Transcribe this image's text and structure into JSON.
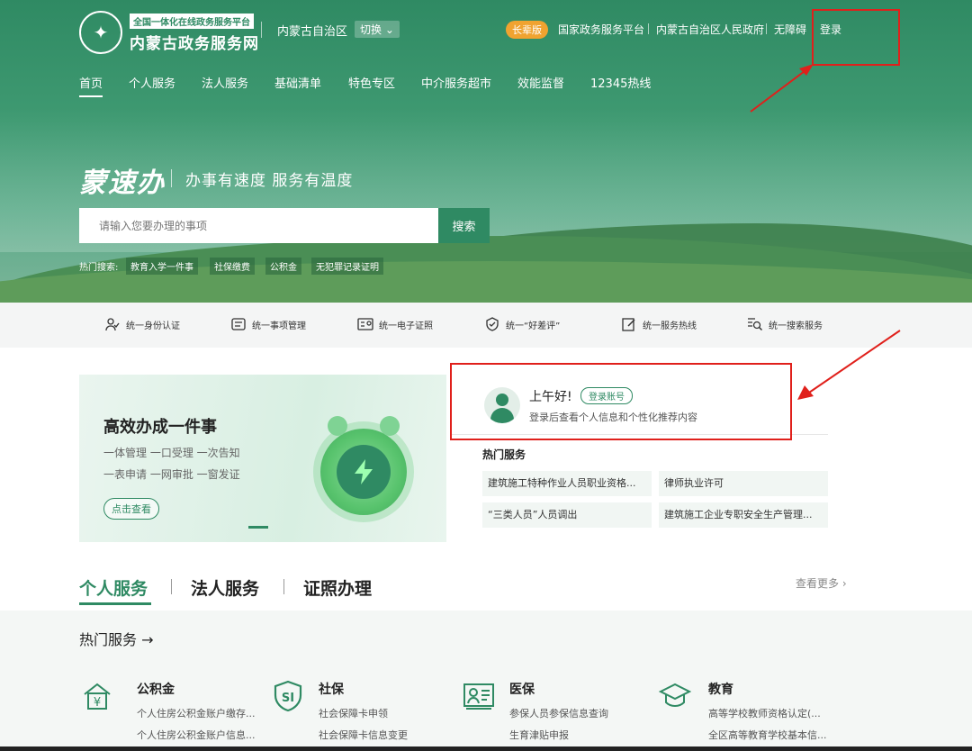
{
  "header": {
    "logo_tagline": "全国一体化在线政务服务平台",
    "logo_title": "内蒙古政务服务网",
    "region": "内蒙古自治区",
    "switch_label": "切换 ⌄",
    "elder_version": "长辈版",
    "links": [
      "国家政务服务平台",
      "内蒙古自治区人民政府",
      "无障碍"
    ],
    "login": "登录"
  },
  "nav": [
    "首页",
    "个人服务",
    "法人服务",
    "基础清单",
    "特色专区",
    "中介服务超市",
    "效能监督",
    "12345热线"
  ],
  "hero": {
    "slogan_big": "蒙速办",
    "slogan_small": "办事有速度 服务有温度",
    "search_placeholder": "请输入您要办理的事项",
    "search_button": "搜索",
    "hot_label": "热门搜索:",
    "hot_tags": [
      "教育入学一件事",
      "社保缴费",
      "公积金",
      "无犯罪记录证明"
    ]
  },
  "features": [
    {
      "icon": "person-verify-icon",
      "label": "统一身份认证"
    },
    {
      "icon": "list-manage-icon",
      "label": "统一事项管理"
    },
    {
      "icon": "license-card-icon",
      "label": "统一电子证照"
    },
    {
      "icon": "rating-shield-icon",
      "label": "统一“好差评”"
    },
    {
      "icon": "edit-icon",
      "label": "统一服务热线"
    },
    {
      "icon": "search-list-icon",
      "label": "统一搜索服务"
    }
  ],
  "promo": {
    "title": "高效办成一件事",
    "lines": [
      "一体管理 一口受理 一次告知",
      "一表申请 一网审批 一窗发证"
    ],
    "button": "点击查看"
  },
  "greeting": {
    "title": "上午好!",
    "login_button": "登录账号",
    "subtitle": "登录后查看个人信息和个性化推荐内容",
    "hot_title": "热门服务",
    "hot_items": [
      "建筑施工特种作业人员职业资格...",
      "律师执业许可",
      "“三类人员”人员调出",
      "建筑施工企业专职安全生产管理..."
    ]
  },
  "tabs": {
    "items": [
      "个人服务",
      "法人服务",
      "证照办理"
    ],
    "more": "查看更多 ›"
  },
  "services": {
    "heading": "热门服务 →",
    "cards": [
      {
        "icon": "housing-fund-icon",
        "title": "公积金",
        "lines": [
          "个人住房公积金账户缴存...",
          "个人住房公积金账户信息..."
        ]
      },
      {
        "icon": "social-security-icon",
        "title": "社保",
        "lines": [
          "社会保障卡申领",
          "社会保障卡信息变更"
        ]
      },
      {
        "icon": "medical-insurance-icon",
        "title": "医保",
        "lines": [
          "参保人员参保信息查询",
          "生育津贴申报"
        ]
      },
      {
        "icon": "education-icon",
        "title": "教育",
        "lines": [
          "高等学校教师资格认定(...",
          "全区高等教育学校基本信..."
        ]
      }
    ]
  },
  "colors": {
    "brand_green": "#2f8a63",
    "annotation_red": "#e0201b",
    "elder_badge": "#f0a330"
  }
}
